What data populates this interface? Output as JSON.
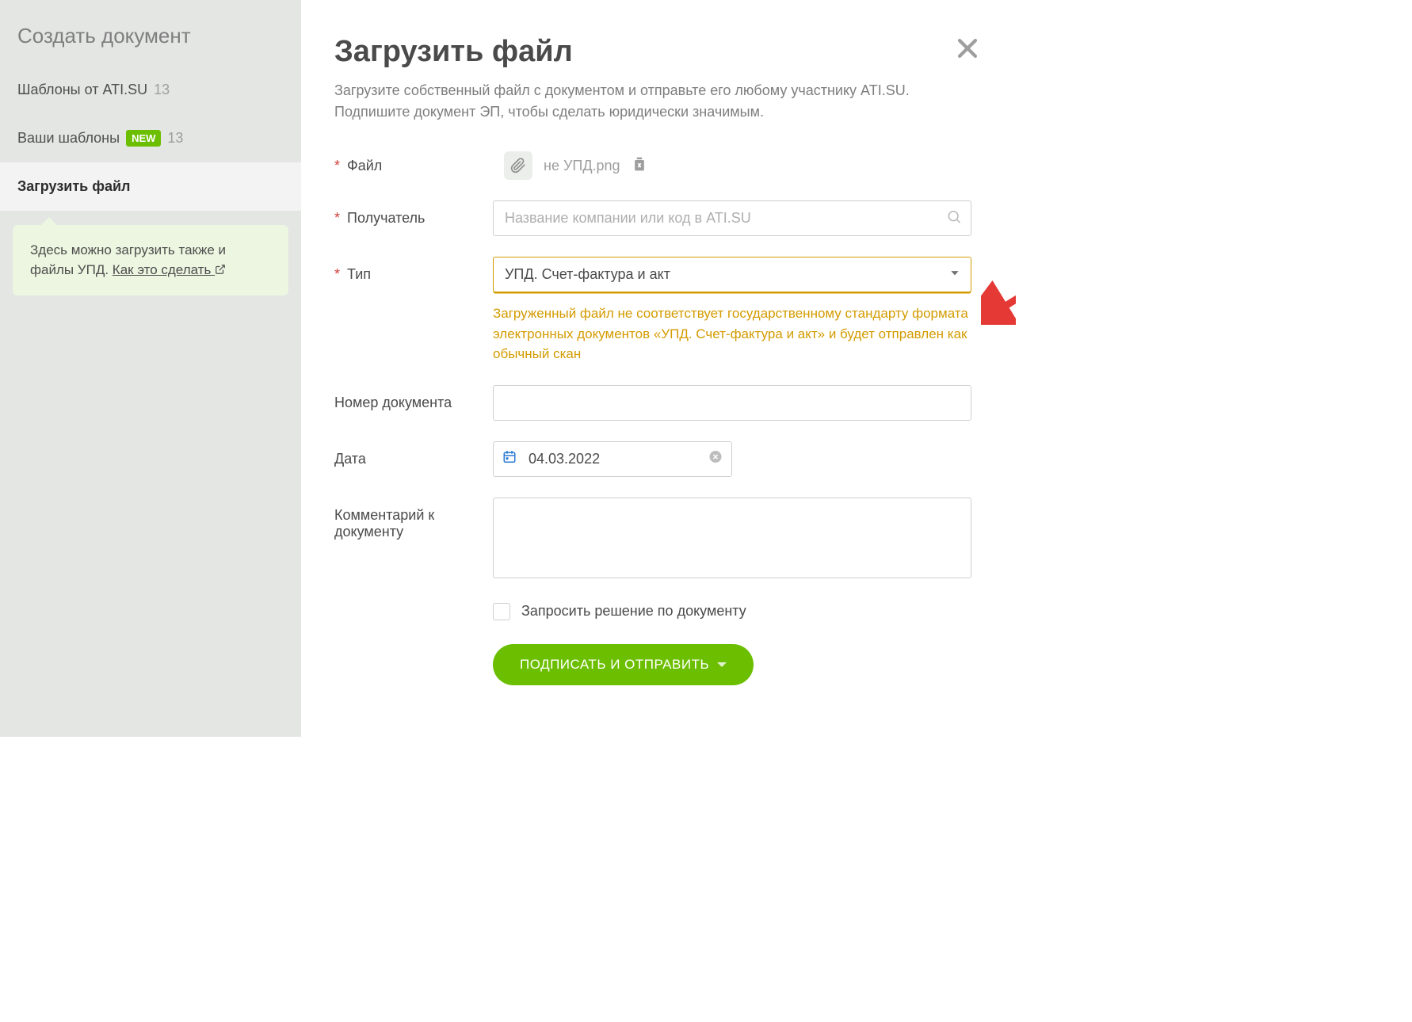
{
  "sidebar": {
    "title": "Создать документ",
    "items": [
      {
        "label": "Шаблоны от ATI.SU",
        "count": "13",
        "new": false
      },
      {
        "label": "Ваши шаблоны",
        "count": "13",
        "new": true,
        "new_label": "NEW"
      },
      {
        "label": "Загрузить файл",
        "count": "",
        "new": false
      }
    ],
    "hint_text": "Здесь можно загрузить также и файлы УПД.",
    "hint_link": "Как это сделать"
  },
  "main": {
    "title": "Загрузить файл",
    "subtitle": "Загрузите собственный файл с документом и отправьте его любому участнику ATI.SU. Подпишите документ ЭП, чтобы сделать юридически значимым.",
    "labels": {
      "file": "Файл",
      "recipient": "Получатель",
      "type": "Тип",
      "doc_number": "Номер документа",
      "date": "Дата",
      "comment": "Комментарий к документу",
      "request_decision": "Запросить решение по документу"
    },
    "file_name": "не УПД.png",
    "recipient_placeholder": "Название компании или код в ATI.SU",
    "type_value": "УПД. Счет-фактура и акт",
    "type_warning": "Загруженный файл не соответствует государственному стандарту формата электронных документов «УПД. Счет-фактура и акт» и будет отправлен как обычный скан",
    "doc_number_value": "",
    "date_value": "04.03.2022",
    "comment_value": "",
    "submit_label": "ПОДПИСАТЬ И ОТПРАВИТЬ"
  }
}
